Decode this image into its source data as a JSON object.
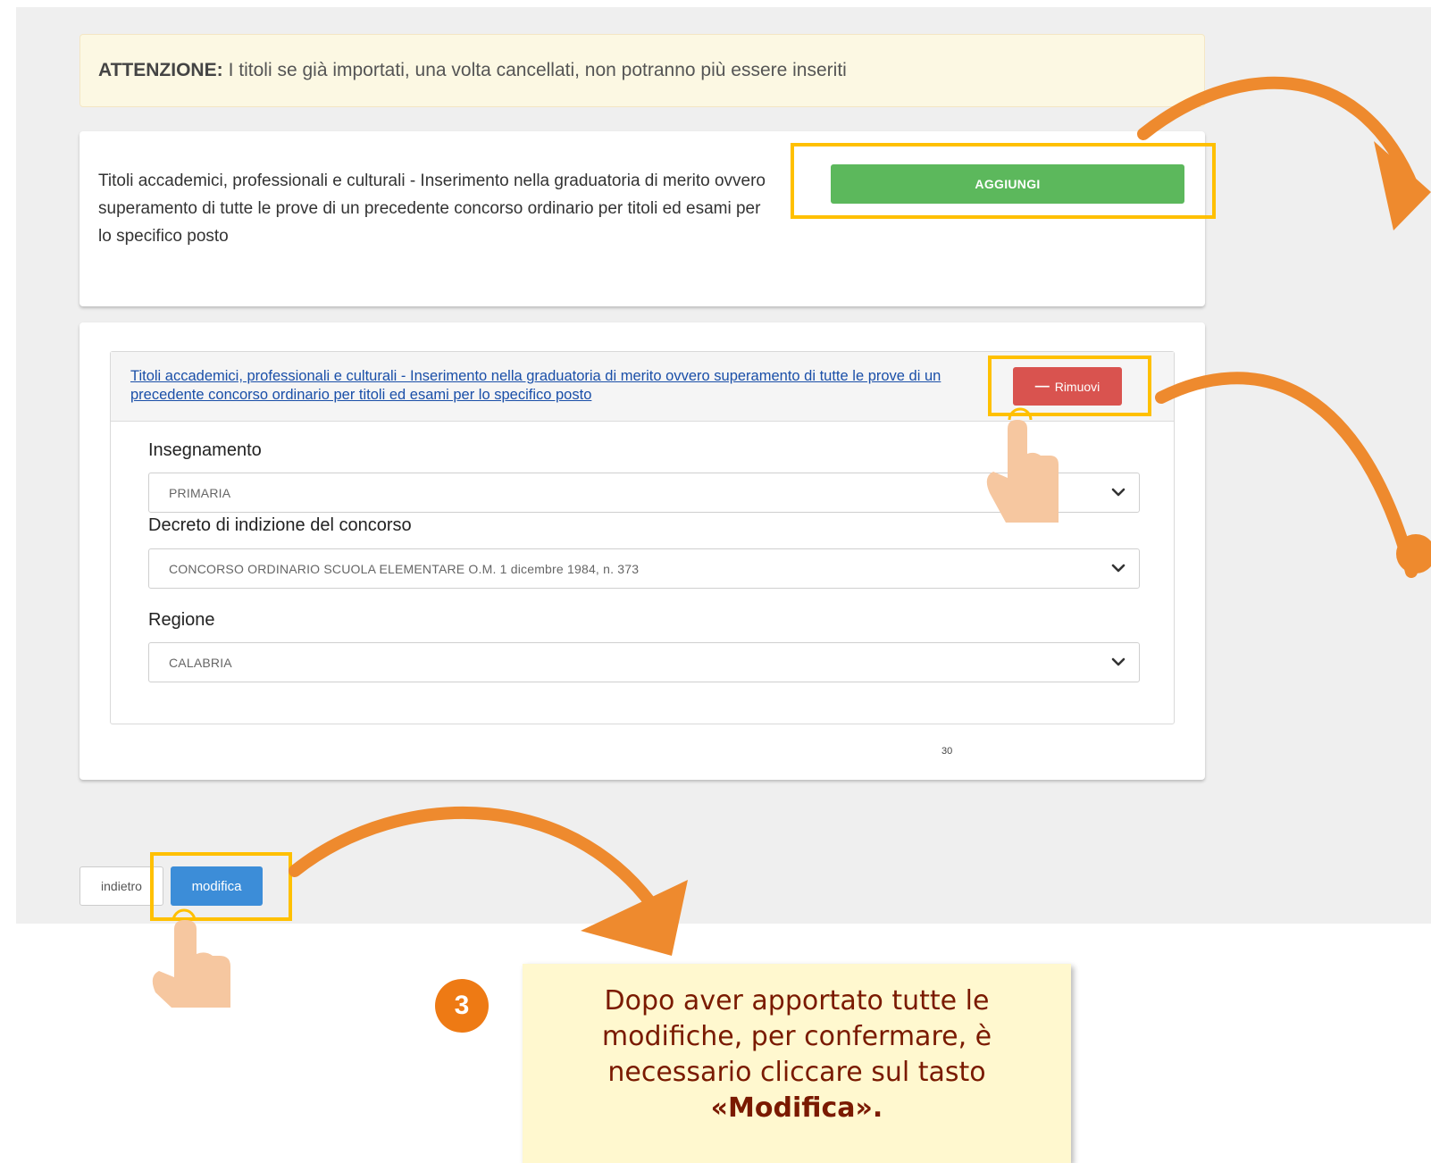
{
  "warning": {
    "strong": "ATTENZIONE:",
    "text": "I titoli se già importati, una volta cancellati, non potranno più essere inseriti"
  },
  "title_section": {
    "description": "Titoli accademici, professionali e culturali - Inserimento nella graduatoria di merito ovvero superamento di tutte le prove di un precedente concorso ordinario per titoli ed esami per lo specifico posto",
    "add_label": "AGGIUNGI"
  },
  "entry": {
    "title_link": "Titoli accademici, professionali e culturali - Inserimento nella graduatoria di merito ovvero superamento di tutte le prove di un precedente concorso ordinario per titoli ed esami per lo specifico posto",
    "remove_label": "Rimuovi",
    "fields": [
      {
        "label": "Insegnamento",
        "value": "PRIMARIA"
      },
      {
        "label": "Decreto di indizione del concorso",
        "value": "CONCORSO ORDINARIO SCUOLA ELEMENTARE O.M. 1 dicembre 1984, n. 373"
      },
      {
        "label": "Regione",
        "value": "CALABRIA"
      }
    ],
    "page_number": "30"
  },
  "footer": {
    "back_label": "indietro",
    "edit_label": "modifica"
  },
  "callout": {
    "step": "3",
    "text": "Dopo aver apportato tutte le modifiche, per confermare, è necessario cliccare sul tasto",
    "bold": "«Modifica»."
  },
  "colors": {
    "highlight": "#ffc000",
    "arrow": "#ee8a2e",
    "add_button": "#5cb85c",
    "remove_button": "#d9534f",
    "edit_button": "#3c8dd8"
  },
  "icons": [
    "chevron-down-icon",
    "minus-icon",
    "pointing-hand-icon",
    "curved-arrow-icon"
  ]
}
